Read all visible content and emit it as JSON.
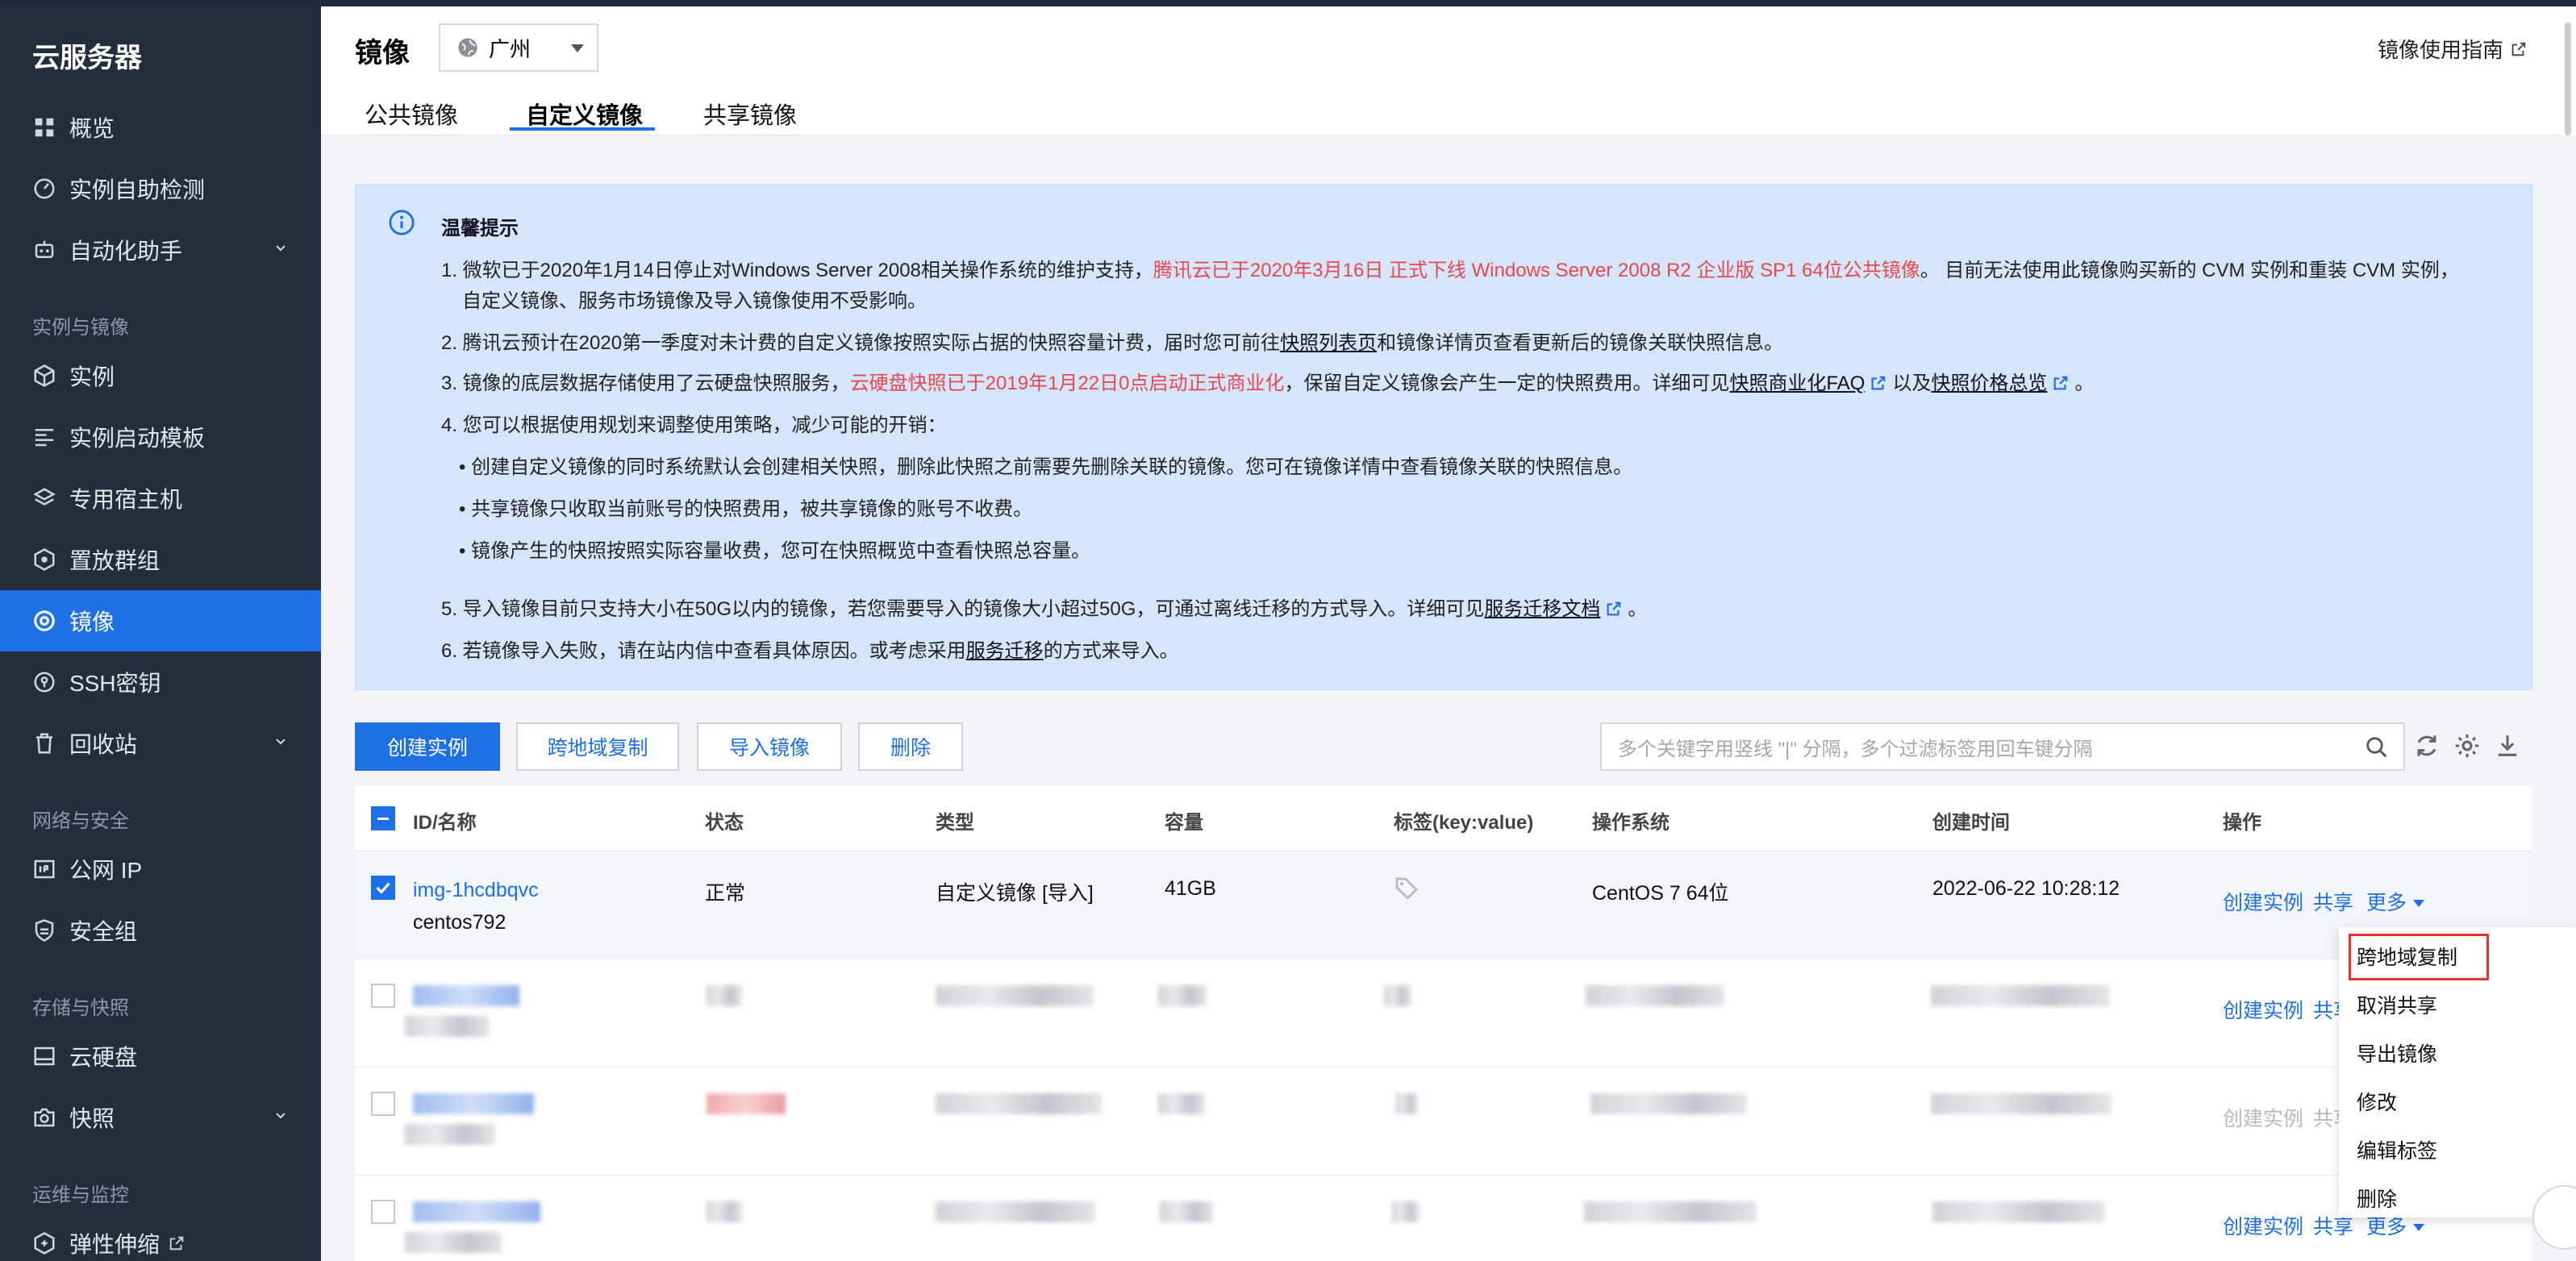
{
  "sidebar": {
    "app_title": "云服务器",
    "items": [
      {
        "label": "概览"
      },
      {
        "label": "实例自助检测"
      },
      {
        "label": "自动化助手"
      },
      {
        "label": "实例"
      },
      {
        "label": "实例启动模板"
      },
      {
        "label": "专用宿主机"
      },
      {
        "label": "置放群组"
      },
      {
        "label": "镜像"
      },
      {
        "label": "SSH密钥"
      },
      {
        "label": "回收站"
      },
      {
        "label": "公网 IP"
      },
      {
        "label": "安全组"
      },
      {
        "label": "云硬盘"
      },
      {
        "label": "快照"
      },
      {
        "label": "弹性伸缩"
      }
    ],
    "groups": [
      "实例与镜像",
      "网络与安全",
      "存储与快照",
      "运维与监控"
    ]
  },
  "header": {
    "title": "镜像",
    "region": "广州",
    "guide_link": "镜像使用指南",
    "tabs": [
      "公共镜像",
      "自定义镜像",
      "共享镜像"
    ],
    "active_tab": "自定义镜像"
  },
  "notice": {
    "title": "温馨提示",
    "l1a": "1. 微软已于2020年1月14日停止对Windows Server 2008相关操作系统的维护支持，",
    "l1b": "腾讯云已于2020年3月16日 正式下线 Windows Server 2008 R2 企业版 SP1 64位公共镜像",
    "l1c": "。 目前无法使用此镜像购买新的 CVM 实例和重装 CVM 实例，",
    "l1d": "自定义镜像、服务市场镜像及导入镜像使用不受影响。",
    "l2a": "2. 腾讯云预计在2020第一季度对未计费的自定义镜像按照实际占据的快照容量计费，届时您可前往",
    "l2b": "快照列表页",
    "l2c": "和镜像详情页查看更新后的镜像关联快照信息。",
    "l3a": "3. 镜像的底层数据存储使用了云硬盘快照服务，",
    "l3b": "云硬盘快照已于2019年1月22日0点启动正式商业化",
    "l3c": "，保留自定义镜像会产生一定的快照费用。详细可见",
    "l3d": "快照商业化FAQ",
    "l3e": "以及",
    "l3f": "快照价格总览",
    "l3g": "。",
    "l4": "4. 您可以根据使用规划来调整使用策略，减少可能的开销：",
    "b1": "创建自定义镜像的同时系统默认会创建相关快照，删除此快照之前需要先删除关联的镜像。您可在镜像详情中查看镜像关联的快照信息。",
    "b2": "共享镜像只收取当前账号的快照费用，被共享镜像的账号不收费。",
    "b3": "镜像产生的快照按照实际容量收费，您可在快照概览中查看快照总容量。",
    "l5a": "5. 导入镜像目前只支持大小在50G以内的镜像，若您需要导入的镜像大小超过50G，可通过离线迁移的方式导入。详细可见",
    "l5b": "服务迁移文档",
    "l5c": "。",
    "l6a": "6. 若镜像导入失败，请在站内信中查看具体原因。或考虑采用",
    "l6b": "服务迁移",
    "l6c": "的方式来导入。"
  },
  "toolbar": {
    "create_instance": "创建实例",
    "cross_region_copy": "跨地域复制",
    "import_image": "导入镜像",
    "delete": "删除",
    "search_placeholder": "多个关键字用竖线 \"|\" 分隔，多个过滤标签用回车键分隔"
  },
  "table": {
    "columns": [
      "ID/名称",
      "状态",
      "类型",
      "容量",
      "标签(key:value)",
      "操作系统",
      "创建时间",
      "操作"
    ],
    "rows": [
      {
        "id": "img-1hcdbqvc",
        "name": "centos792",
        "status": "正常",
        "type": "自定义镜像 [导入]",
        "capacity": "41GB",
        "os": "CentOS 7 64位",
        "created": "2022-06-22 10:28:12",
        "actions": [
          "创建实例",
          "共享",
          "更多"
        ]
      }
    ],
    "other_row_action": "创建实例",
    "other_row_share": "共享",
    "other_row_more": "更多"
  },
  "more_menu": {
    "items": [
      "跨地域复制",
      "取消共享",
      "导出镜像",
      "修改",
      "编辑标签",
      "删除"
    ],
    "highlighted": "跨地域复制"
  },
  "colors": {
    "sidebar_bg": "#232d3b",
    "accent": "#1f6fe5",
    "notice_bg": "#d5e5fb",
    "warning_red": "#e5484d",
    "highlight_box": "#e5312f"
  }
}
